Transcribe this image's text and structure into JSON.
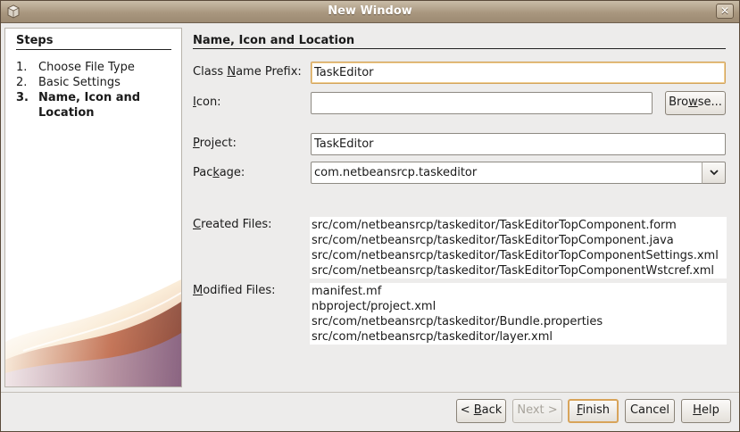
{
  "window": {
    "title": "New Window",
    "close_glyph": "✕",
    "icons": [
      "app-icon",
      "close-icon"
    ]
  },
  "steps": {
    "title": "Steps",
    "items": [
      {
        "num": "1.",
        "label": "Choose File Type",
        "current": false
      },
      {
        "num": "2.",
        "label": "Basic Settings",
        "current": false
      },
      {
        "num": "3.",
        "label": "Name, Icon and Location",
        "current": true
      }
    ]
  },
  "panel": {
    "title": "Name, Icon and Location",
    "class_prefix": {
      "label_pre": "Class ",
      "mnemonic": "N",
      "label_post": "ame Prefix:",
      "value": "TaskEditor"
    },
    "icon": {
      "mnemonic": "I",
      "label_post": "con:",
      "value": ""
    },
    "browse": {
      "label_pre": "Bro",
      "mnemonic": "w",
      "label_post": "se..."
    },
    "project": {
      "mnemonic": "P",
      "label_post": "roject:",
      "value": "TaskEditor"
    },
    "package": {
      "label_pre": "Pac",
      "mnemonic": "k",
      "label_post": "age:",
      "value": "com.netbeansrcp.taskeditor"
    },
    "created": {
      "mnemonic": "C",
      "label_post": "reated Files:",
      "files": [
        "src/com/netbeansrcp/taskeditor/TaskEditorTopComponent.form",
        "src/com/netbeansrcp/taskeditor/TaskEditorTopComponent.java",
        "src/com/netbeansrcp/taskeditor/TaskEditorTopComponentSettings.xml",
        "src/com/netbeansrcp/taskeditor/TaskEditorTopComponentWstcref.xml"
      ]
    },
    "modified": {
      "mnemonic": "M",
      "label_post": "odified Files:",
      "files": [
        "manifest.mf",
        "nbproject/project.xml",
        "src/com/netbeansrcp/taskeditor/Bundle.properties",
        "src/com/netbeansrcp/taskeditor/layer.xml"
      ]
    }
  },
  "buttons": {
    "back": {
      "label_pre": "< ",
      "mnemonic": "B",
      "label_post": "ack"
    },
    "next": {
      "label": "Next >"
    },
    "finish": {
      "mnemonic": "F",
      "label_post": "inish"
    },
    "cancel": {
      "label": "Cancel"
    },
    "help": {
      "mnemonic": "H",
      "label_post": "elp"
    }
  }
}
